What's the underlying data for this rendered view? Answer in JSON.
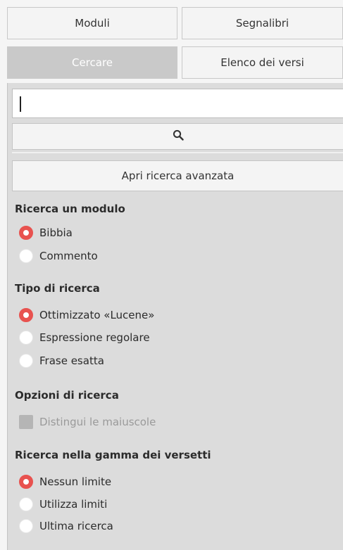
{
  "tabs": {
    "moduli": "Moduli",
    "segnalibri": "Segnalibri",
    "cercare": "Cercare",
    "elenco": "Elenco dei versi"
  },
  "search": {
    "input_value": "",
    "advanced_label": "Apri ricerca avanzata"
  },
  "sections": {
    "module": {
      "title": "Ricerca un modulo",
      "options": [
        "Bibbia",
        "Commento"
      ],
      "selected": "Bibbia"
    },
    "type": {
      "title": "Tipo di ricerca",
      "options": [
        "Ottimizzato «Lucene»",
        "Espressione regolare",
        "Frase esatta"
      ],
      "selected": "Ottimizzato «Lucene»"
    },
    "options": {
      "title": "Opzioni di ricerca",
      "case_sensitive_label": "Distingui le maiuscole",
      "case_sensitive_enabled": false
    },
    "range": {
      "title": "Ricerca nella gamma dei versetti",
      "options": [
        "Nessun limite",
        "Utilizza limiti",
        "Ultima ricerca"
      ],
      "selected": "Nessun limite"
    }
  },
  "colors": {
    "accent": "#e8524f",
    "active_tab": "#c9c9c9",
    "panel": "#dcdcdc"
  },
  "icons": {
    "search_button": "search-icon"
  }
}
